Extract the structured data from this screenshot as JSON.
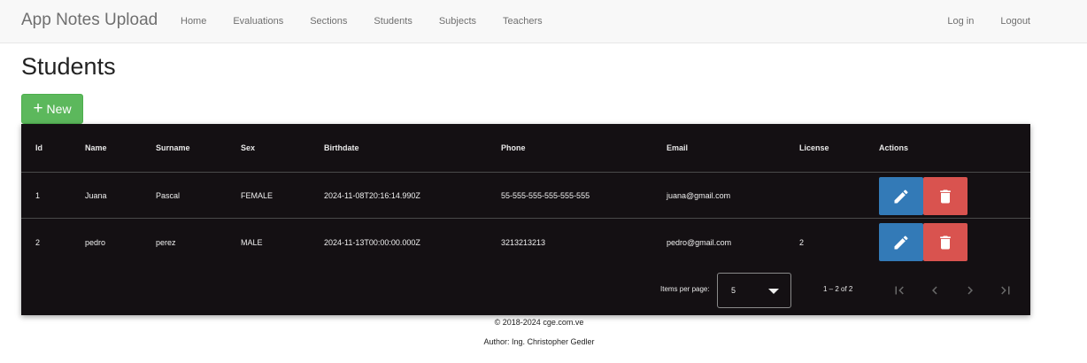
{
  "navbar": {
    "brand": "App Notes Upload",
    "links": [
      "Home",
      "Evaluations",
      "Sections",
      "Students",
      "Subjects",
      "Teachers"
    ],
    "right_links": [
      "Log in",
      "Logout"
    ]
  },
  "page": {
    "title": "Students",
    "new_button": "New",
    "new_icon": "plus-icon"
  },
  "table": {
    "columns": [
      "Id",
      "Name",
      "Surname",
      "Sex",
      "Birthdate",
      "Phone",
      "Email",
      "License",
      "Actions"
    ],
    "rows": [
      {
        "id": "1",
        "name": "Juana",
        "surname": "Pascal",
        "sex": "FEMALE",
        "birthdate": "2024-11-08T20:16:14.990Z",
        "phone": "55-555-555-555-555-555",
        "email": "juana@gmail.com",
        "license": ""
      },
      {
        "id": "2",
        "name": "pedro",
        "surname": "perez",
        "sex": "MALE",
        "birthdate": "2024-11-13T00:00:00.000Z",
        "phone": "3213213213",
        "email": "pedro@gmail.com",
        "license": "2"
      }
    ],
    "action_icons": [
      "pencil-icon",
      "trash-icon"
    ],
    "colors": {
      "background": "#141013",
      "edit": "#337ab7",
      "delete": "#d9534f",
      "new": "#5cb85c"
    }
  },
  "paginator": {
    "items_per_page_label": "Items per page:",
    "items_per_page_value": "5",
    "range_label": "1 – 2 of 2",
    "icons": [
      "first-page-icon",
      "chevron-left-icon",
      "chevron-right-icon",
      "last-page-icon"
    ]
  },
  "footer": {
    "copyright": "© 2018-2024 cge.com.ve",
    "author": "Author: Ing. Christopher Gedler"
  }
}
